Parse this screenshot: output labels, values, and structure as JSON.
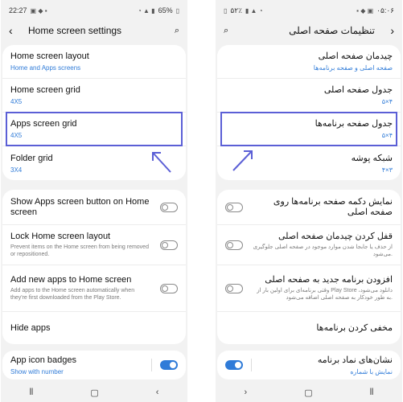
{
  "left": {
    "status": {
      "time": "22:27",
      "battery": "65%"
    },
    "title": "Home screen settings",
    "rows": [
      {
        "label": "Home screen layout",
        "sub": "Home and Apps screens"
      },
      {
        "label": "Home screen grid",
        "sub": "4X5"
      },
      {
        "label": "Apps screen grid",
        "sub": "4X5"
      },
      {
        "label": "Folder grid",
        "sub": "3X4"
      }
    ],
    "toggles": [
      {
        "label": "Show Apps screen button on Home screen",
        "desc": ""
      },
      {
        "label": "Lock Home screen layout",
        "desc": "Prevent items on the Home screen from being removed or repositioned."
      },
      {
        "label": "Add new apps to Home screen",
        "desc": "Add apps to the Home screen automatically when they're first downloaded from the Play Store."
      }
    ],
    "hide_apps": "Hide apps",
    "badges": {
      "label": "App icon badges",
      "sub": "Show with number",
      "enabled": true
    }
  },
  "right": {
    "status": {
      "time": "۰۵:۰۶",
      "battery": "۵۲٪"
    },
    "title": "تنظیمات صفحه اصلی",
    "rows": [
      {
        "label": "چیدمان صفحه اصلی",
        "sub": "صفحه اصلی و صفحه برنامه‌ها"
      },
      {
        "label": "جدول صفحه اصلی",
        "sub": "۵×۴"
      },
      {
        "label": "جدول صفحه برنامه‌ها",
        "sub": "۵×۴"
      },
      {
        "label": "شبکه پوشه",
        "sub": "۴×۳"
      }
    ],
    "toggles": [
      {
        "label": "نمایش دکمه صفحه برنامه‌ها روی صفحه اصلی",
        "desc": ""
      },
      {
        "label": "قفل کردن چیدمان صفحه اصلی",
        "desc": "از حذف یا جابجا شدن موارد موجود در صفحه اصلی جلوگیری می‌شود."
      },
      {
        "label": "افزودن برنامه جدید به صفحه اصلی",
        "desc": "وقتی برنامه‌ای برای اولین بار از Play Store دانلود می‌شود، به طور خودکار به صفحه اصلی اضافه می‌شود."
      }
    ],
    "hide_apps": "مخفی کردن برنامه‌ها",
    "badges": {
      "label": "نشان‌های نماد برنامه",
      "sub": "نمایش با شماره",
      "enabled": true
    }
  },
  "colors": {
    "accent": "#2f7bd8",
    "highlight": "#5b5fd6"
  }
}
